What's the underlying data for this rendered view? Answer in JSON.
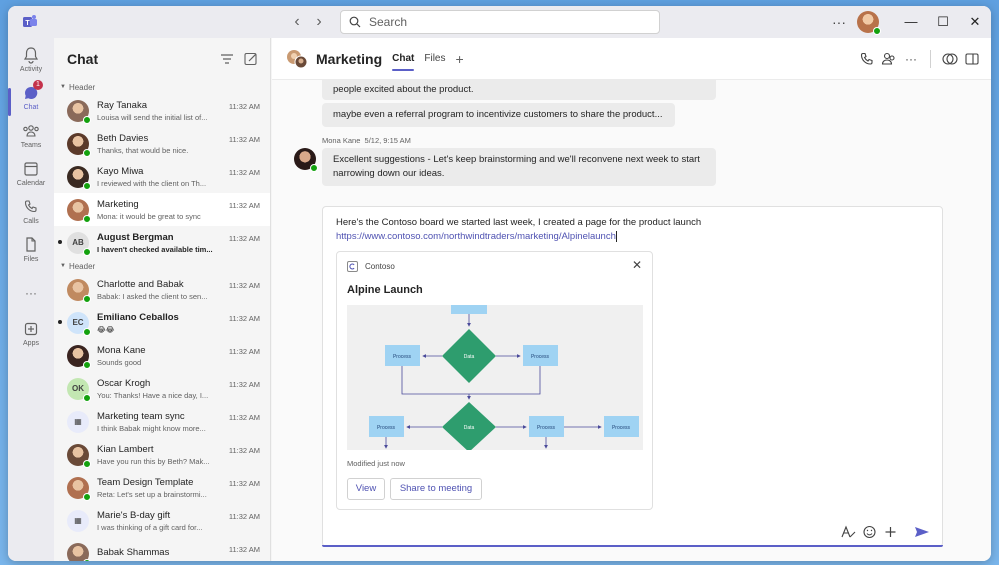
{
  "titlebar": {
    "back_icon": "chevron-left-icon",
    "forward_icon": "chevron-right-icon",
    "search_placeholder": "Search",
    "more_label": "···"
  },
  "rail": {
    "items": [
      {
        "label": "Activity",
        "icon": "bell-icon"
      },
      {
        "label": "Chat",
        "icon": "chat-icon",
        "badge": "1"
      },
      {
        "label": "Teams",
        "icon": "teams-icon"
      },
      {
        "label": "Calendar",
        "icon": "calendar-icon"
      },
      {
        "label": "Calls",
        "icon": "phone-icon"
      },
      {
        "label": "Files",
        "icon": "file-icon"
      },
      {
        "label": "···",
        "icon": "more-icon"
      },
      {
        "label": "Apps",
        "icon": "apps-icon"
      }
    ]
  },
  "chatlist": {
    "title": "Chat",
    "sections": [
      {
        "header": "Header",
        "chats": [
          {
            "name": "Ray Tanaka",
            "preview": "Louisa will send the initial list of...",
            "time": "11:32 AM",
            "avatar_color": "#8a6a5a",
            "initials": ""
          },
          {
            "name": "Beth Davies",
            "preview": "Thanks, that would be nice.",
            "time": "11:32 AM",
            "avatar_color": "#5b3a2a",
            "initials": ""
          },
          {
            "name": "Kayo Miwa",
            "preview": "I reviewed with the client on Th...",
            "time": "11:32 AM",
            "avatar_color": "#3a2a22",
            "initials": ""
          },
          {
            "name": "Marketing",
            "preview": "Mona: it would be great to sync",
            "time": "11:32 AM",
            "avatar_color": "#b07050",
            "initials": "",
            "active": true
          },
          {
            "name": "August Bergman",
            "preview": "I haven't checked available tim...",
            "time": "11:32 AM",
            "avatar_color": "#e0e0e0",
            "initials": "AB",
            "unread": true
          }
        ]
      },
      {
        "header": "Header",
        "chats": [
          {
            "name": "Charlotte and Babak",
            "preview": "Babak: I asked the client to sen...",
            "time": "11:32 AM",
            "avatar_color": "#c08a60",
            "initials": ""
          },
          {
            "name": "Emiliano Ceballos",
            "preview": "😂😂",
            "time": "11:32 AM",
            "avatar_color": "#cfe4fa",
            "initials": "EC",
            "unread": true
          },
          {
            "name": "Mona Kane",
            "preview": "Sounds good",
            "time": "11:32 AM",
            "avatar_color": "#3a2420",
            "initials": ""
          },
          {
            "name": "Oscar Krogh",
            "preview": "You: Thanks! Have a nice day, I...",
            "time": "11:32 AM",
            "avatar_color": "#c3e7b2",
            "initials": "OK"
          },
          {
            "name": "Marketing team sync",
            "preview": "I think Babak might know more...",
            "time": "11:32 AM",
            "avatar_color": "#e8ebfa",
            "initials": "▦"
          },
          {
            "name": "Kian Lambert",
            "preview": "Have you run this by Beth? Mak...",
            "time": "11:32 AM",
            "avatar_color": "#6a4a38",
            "initials": ""
          },
          {
            "name": "Team Design Template",
            "preview": "Reta: Let's set up a brainstormi...",
            "time": "11:32 AM",
            "avatar_color": "#b07050",
            "initials": ""
          },
          {
            "name": "Marie's B-day gift",
            "preview": "I was thinking of a gift card for...",
            "time": "11:32 AM",
            "avatar_color": "#e8ebfa",
            "initials": "▦"
          },
          {
            "name": "Babak Shammas",
            "preview": "",
            "time": "11:32 AM",
            "avatar_color": "#8a6a5a",
            "initials": ""
          }
        ]
      }
    ]
  },
  "conversation": {
    "title": "Marketing",
    "tabs": [
      "Chat",
      "Files"
    ],
    "messages": [
      {
        "text": "people excited about the product."
      },
      {
        "text": "maybe even a referral program to incentivize customers to share the product..."
      }
    ],
    "mona": {
      "author": "Mona Kane",
      "time": "5/12, 9:15 AM",
      "text": "Excellent suggestions - Let's keep brainstorming and we'll reconvene next week to start narrowing down our ideas."
    }
  },
  "compose": {
    "text": "Here's the Contoso board we started last week, I created a page for the product launch ",
    "link": "https://www.contoso.com/northwindtraders/marketing/Alpinelaunch",
    "card": {
      "source": "Contoso",
      "title": "Alpine Launch",
      "modified": "Modified just now",
      "view_label": "View",
      "share_label": "Share to meeting",
      "diagram": {
        "process_label": "Process",
        "data_label": "Data"
      }
    }
  },
  "colors": {
    "accent": "#5b5fc7",
    "presence": "#13a10e",
    "badge": "#c4314b",
    "diagram_process": "#9fd3f3",
    "diagram_data": "#2e9d6e"
  }
}
